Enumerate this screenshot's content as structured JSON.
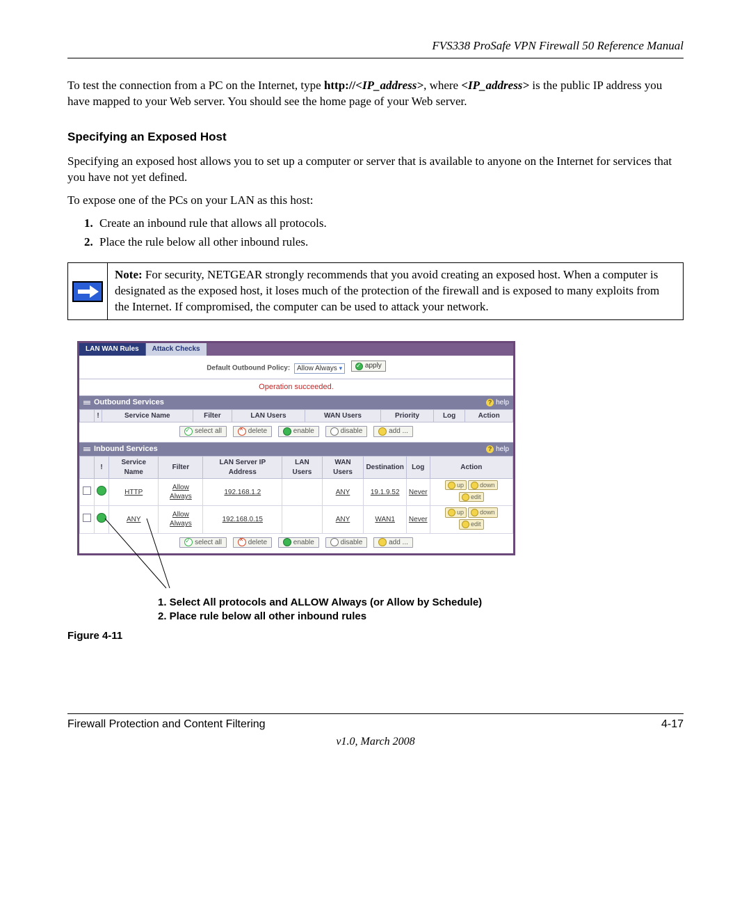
{
  "header": {
    "title": "FVS338 ProSafe VPN Firewall 50 Reference Manual"
  },
  "intro": {
    "p1_a": "To test the connection from a PC on the Internet, type ",
    "p1_b": "http://",
    "p1_c": "<IP_address>",
    "p1_d": ", where ",
    "p1_e": "<IP_address>",
    "p1_f": " is the public IP address you have mapped to your Web server. You should see the home page of your Web server."
  },
  "section": {
    "heading": "Specifying an Exposed Host",
    "p2": "Specifying an exposed host allows you to set up a computer or server that is available to anyone on the Internet for services that you have not yet defined.",
    "p3": "To expose one of the PCs on your LAN as this host:",
    "step1": "Create an inbound rule that allows all protocols.",
    "step2": "Place the rule below all other inbound rules."
  },
  "note": {
    "label": "Note:",
    "text": " For security, NETGEAR strongly recommends that you avoid creating an exposed host. When a computer is designated as the exposed host, it loses much of the protection of the firewall and is exposed to many exploits from the Internet. If compromised, the computer can be used to attack your network."
  },
  "ui": {
    "tabs": {
      "active": "LAN WAN Rules",
      "other": "Attack Checks"
    },
    "policy": {
      "label": "Default Outbound Policy:",
      "select": "Allow Always",
      "apply": "apply"
    },
    "status": "Operation succeeded.",
    "outbound": {
      "title": "Outbound Services",
      "help": "help",
      "headers": [
        "!",
        "Service Name",
        "Filter",
        "LAN Users",
        "WAN Users",
        "Priority",
        "Log",
        "Action"
      ]
    },
    "inbound": {
      "title": "Inbound Services",
      "help": "help",
      "headers": [
        "!",
        "Service Name",
        "Filter",
        "LAN Server IP Address",
        "LAN Users",
        "WAN Users",
        "Destination",
        "Log",
        "Action"
      ],
      "rows": [
        {
          "svc": "HTTP",
          "filter": "Allow Always",
          "lanip": "192.168.1.2",
          "lanu": "",
          "wanu": "ANY",
          "dest": "19.1.9.52",
          "log": "Never",
          "a1": "up",
          "a2": "down",
          "a3": "edit"
        },
        {
          "svc": "ANY",
          "filter": "Allow Always",
          "lanip": "192.168.0.15",
          "lanu": "",
          "wanu": "ANY",
          "dest": "WAN1",
          "log": "Never",
          "a1": "up",
          "a2": "down",
          "a3": "edit"
        }
      ]
    },
    "buttons": {
      "selectall": "select all",
      "delete": "delete",
      "enable": "enable",
      "disable": "disable",
      "add": "add ..."
    }
  },
  "callout": {
    "line1": "1. Select All protocols and ALLOW Always (or Allow by Schedule)",
    "line2": "2. Place rule below all other inbound rules"
  },
  "figure": "Figure 4-11",
  "footer": {
    "left": "Firewall Protection and Content Filtering",
    "right": "4-17",
    "version": "v1.0, March 2008"
  }
}
